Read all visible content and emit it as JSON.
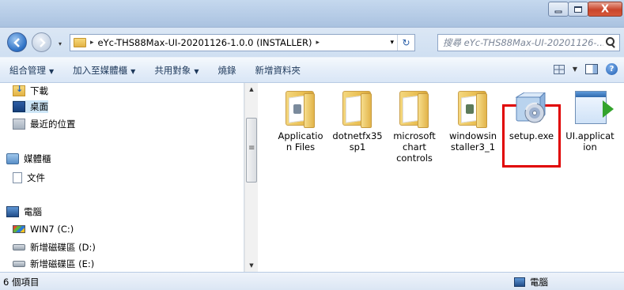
{
  "window": {
    "buttons": {
      "minimize": "",
      "maximize": "",
      "close": "X"
    }
  },
  "address": {
    "breadcrumb_sep": "▸",
    "path": "eYc-THS88Max-UI-20201126-1.0.0 (INSTALLER)",
    "trail_sep": "▸",
    "dropdown": "▾",
    "refresh": "↻"
  },
  "search": {
    "placeholder": "搜尋 eYc-THS88Max-UI-20201126-..."
  },
  "toolbar": {
    "organize": "組合管理",
    "add_to_library": "加入至媒體櫃",
    "share": "共用對象",
    "burn": "燒錄",
    "new_folder": "新增資料夾",
    "dropdown_glyph": "▼",
    "help": "?"
  },
  "nav": {
    "items": [
      {
        "label": "下載",
        "icon": "downloads-icon",
        "selected": false
      },
      {
        "label": "桌面",
        "icon": "desktop-icon",
        "selected": true
      },
      {
        "label": "最近的位置",
        "icon": "recent-places-icon",
        "selected": false
      },
      {
        "label": "媒體櫃",
        "icon": "library-icon",
        "selected": false
      },
      {
        "label": "文件",
        "icon": "documents-icon",
        "selected": false
      },
      {
        "label": "電腦",
        "icon": "computer-icon",
        "selected": false
      },
      {
        "label": "WIN7 (C:)",
        "icon": "windows-drive-icon",
        "selected": false
      },
      {
        "label": "新增磁碟區 (D:)",
        "icon": "drive-icon",
        "selected": false
      },
      {
        "label": "新增磁碟區 (E:)",
        "icon": "drive-icon",
        "selected": false
      }
    ]
  },
  "files": [
    {
      "name": "Application Files",
      "icon": "folder-icon"
    },
    {
      "name": "dotnetfx35sp1",
      "icon": "folder-icon"
    },
    {
      "name": "microsoft chart controls",
      "icon": "folder-icon"
    },
    {
      "name": "windowsinstaller3_1",
      "icon": "folder-icon"
    },
    {
      "name": "setup.exe",
      "icon": "setup-exe-icon",
      "highlighted": true
    },
    {
      "name": "UI.application",
      "icon": "application-manifest-icon"
    }
  ],
  "file_labels": {
    "f0": "Applicatio\nn Files",
    "f1": "dotnetfx35\nsp1",
    "f2": "microsoft\nchart\ncontrols",
    "f3": "windowsin\nstaller3_1",
    "f4": "setup.exe",
    "f5": "UI.applicat\nion"
  },
  "status": {
    "item_count": "6 個項目",
    "location": "電腦"
  },
  "colors": {
    "highlight_border": "#e00000",
    "selection": "#cde6f7",
    "accent_text": "#1e395b"
  }
}
